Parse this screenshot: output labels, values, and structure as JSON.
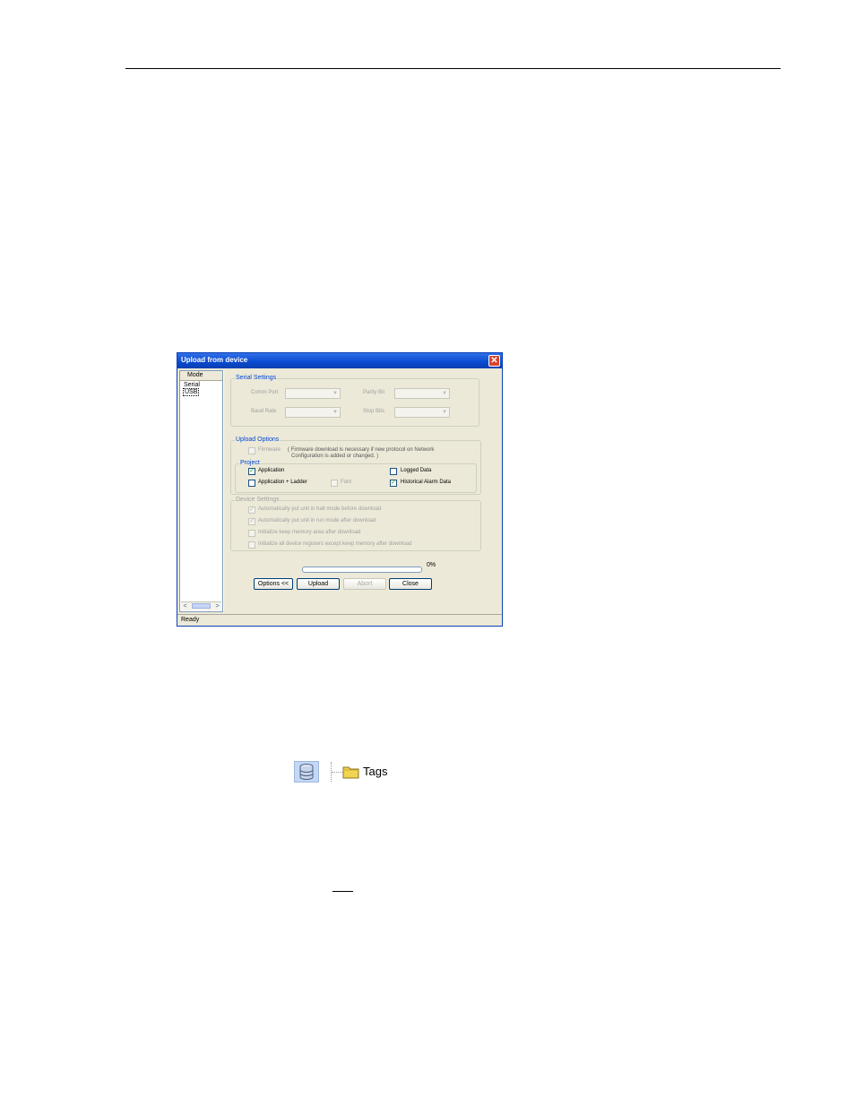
{
  "dialog": {
    "title": "Upload from device",
    "close_glyph": "✕",
    "sidebar": {
      "header": "Mode",
      "items": [
        "Serial",
        "USB"
      ],
      "selected": "USB",
      "scroll_left": "<",
      "scroll_right": ">"
    },
    "serial_settings": {
      "title": "Serial Settings",
      "comm_port_label": "Comm Port",
      "baud_rate_label": "Baud Rate",
      "parity_label": "Parity Bit",
      "stop_bits_label": "Stop Bits"
    },
    "upload_options": {
      "title": "Upload Options",
      "firmware_label": "Firmware",
      "firmware_note_1": "( Firmware download is necessary if new protocol on Network",
      "firmware_note_2": "Configuration is added or changed. )",
      "project_title": "Project",
      "application_label": "Application",
      "application_checked": true,
      "app_ladder_label": "Application + Ladder",
      "app_ladder_checked": false,
      "font_label": "Font",
      "logged_data_label": "Logged Data",
      "logged_data_checked": false,
      "historical_alarm_label": "Historical Alarm Data",
      "historical_alarm_checked": true
    },
    "device_settings": {
      "title": "Device Settings",
      "items": [
        {
          "label": "Automatically put unit in halt mode before download",
          "checked": true
        },
        {
          "label": "Automatically put unit in run mode after download",
          "checked": true
        },
        {
          "label": "Initialize keep memory area after download",
          "checked": false
        },
        {
          "label": "Initialize all device registers except keep memory after download",
          "checked": false
        }
      ]
    },
    "progress": {
      "percent_text": "0%",
      "value": 0
    },
    "buttons": {
      "options": "Options <<",
      "upload": "Upload",
      "abort": "Abort",
      "close": "Close"
    },
    "status": "Ready"
  },
  "toolbar_row": {
    "db_icon": "database-icon",
    "folder_icon": "folder-icon",
    "tags_label": "Tags"
  }
}
